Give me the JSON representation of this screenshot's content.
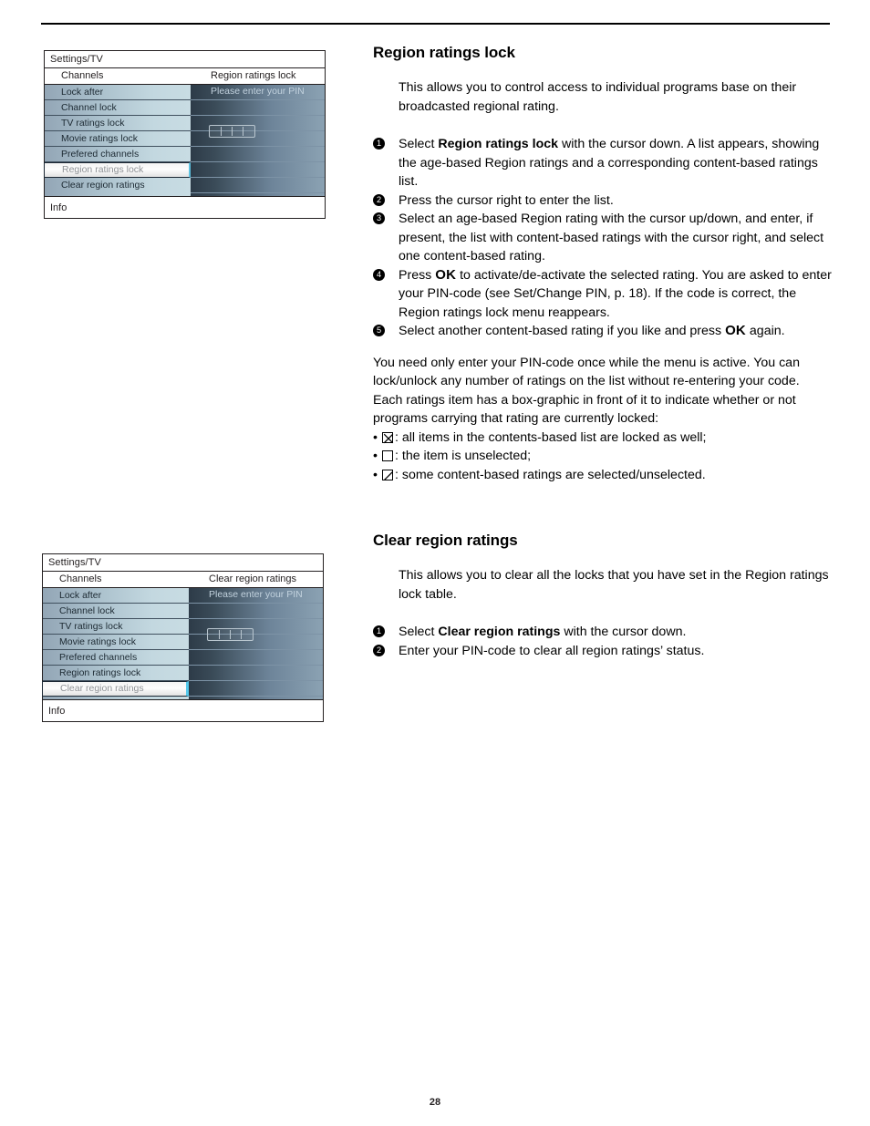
{
  "page": {
    "number": "28"
  },
  "menu_one": {
    "title": "Settings/TV",
    "col_left_header": "Channels",
    "col_right_header": "Region ratings lock",
    "items": [
      {
        "label": "Lock after",
        "selected": false
      },
      {
        "label": "Channel lock",
        "selected": false
      },
      {
        "label": "TV ratings lock",
        "selected": false
      },
      {
        "label": "Movie ratings lock",
        "selected": false
      },
      {
        "label": "Prefered channels",
        "selected": false
      },
      {
        "label": "Region ratings lock",
        "selected": true
      },
      {
        "label": "Clear region ratings",
        "selected": false
      }
    ],
    "pin_prompt": "Please enter your PIN",
    "pin_cells": 4,
    "info_label": "Info"
  },
  "menu_two": {
    "title": "Settings/TV",
    "col_left_header": "Channels",
    "col_right_header": "Clear region ratings",
    "items": [
      {
        "label": "Lock after",
        "selected": false
      },
      {
        "label": "Channel lock",
        "selected": false
      },
      {
        "label": "TV ratings lock",
        "selected": false
      },
      {
        "label": "Movie ratings lock",
        "selected": false
      },
      {
        "label": "Prefered channels",
        "selected": false
      },
      {
        "label": "Region ratings lock",
        "selected": false
      },
      {
        "label": "Clear region ratings",
        "selected": true
      }
    ],
    "pin_prompt": "Please enter your PIN",
    "pin_cells": 4,
    "info_label": "Info"
  },
  "section_region": {
    "title": "Region ratings lock",
    "intro": "This allows you to control access to individual programs base on their broadcasted regional rating.",
    "steps": [
      {
        "num": "1",
        "pre": "Select ",
        "bold": "Region ratings lock",
        "post": " with the cursor down. A list appears, showing the age-based Region ratings and a corresponding content-based ratings list."
      },
      {
        "num": "2",
        "pre": "Press the cursor right to enter the list.",
        "bold": "",
        "post": ""
      },
      {
        "num": "3",
        "pre": "Select an age-based Region rating with the cursor up/down, and enter, if present, the list with content-based ratings with the cursor right, and select one content-based rating.",
        "bold": "",
        "post": ""
      },
      {
        "num": "4",
        "pre": "Press ",
        "bold": "OK",
        "post": " to activate/de-activate the selected rating. You are asked to enter your PIN-code (see Set/Change PIN, p. 18). If the code is correct, the Region ratings lock menu reappears."
      },
      {
        "num": "5",
        "pre": "Select another content-based rating if you like and press ",
        "bold": "OK",
        "post": " again."
      }
    ],
    "note_para_1": "You need only enter your PIN-code once while the menu is active. You can lock/unlock any number of ratings on the list without re-entering your code.",
    "note_para_2": "Each ratings item has a box-graphic in front of it to indicate whether or not programs carrying that rating are currently locked:",
    "bullets": [
      {
        "icon": "checkbox-x-icon",
        "text": ": all items in the contents-based list are locked as well;"
      },
      {
        "icon": "checkbox-empty-icon",
        "text": ": the item is unselected;"
      },
      {
        "icon": "checkbox-slash-icon",
        "text": ": some content-based ratings are selected/unselected."
      }
    ]
  },
  "section_clear": {
    "title": "Clear region ratings",
    "intro": "This allows you to clear all the locks that you have set in the Region ratings lock table.",
    "steps": [
      {
        "num": "1",
        "pre": "Select ",
        "bold": "Clear region ratings",
        "post": " with the cursor down."
      },
      {
        "num": "2",
        "pre": "Enter your PIN-code to clear all region ratings’ status.",
        "bold": "",
        "post": ""
      }
    ]
  },
  "colors": {
    "osd_border": "#231f20",
    "osd_list_gradient_start": "#93a6b6",
    "osd_list_gradient_end": "#c8dce3",
    "osd_detail_dark": "#2d3b48",
    "osd_detail_light": "#8ba2b3",
    "selection_edge": "#55c9ec",
    "text": "#000000"
  }
}
